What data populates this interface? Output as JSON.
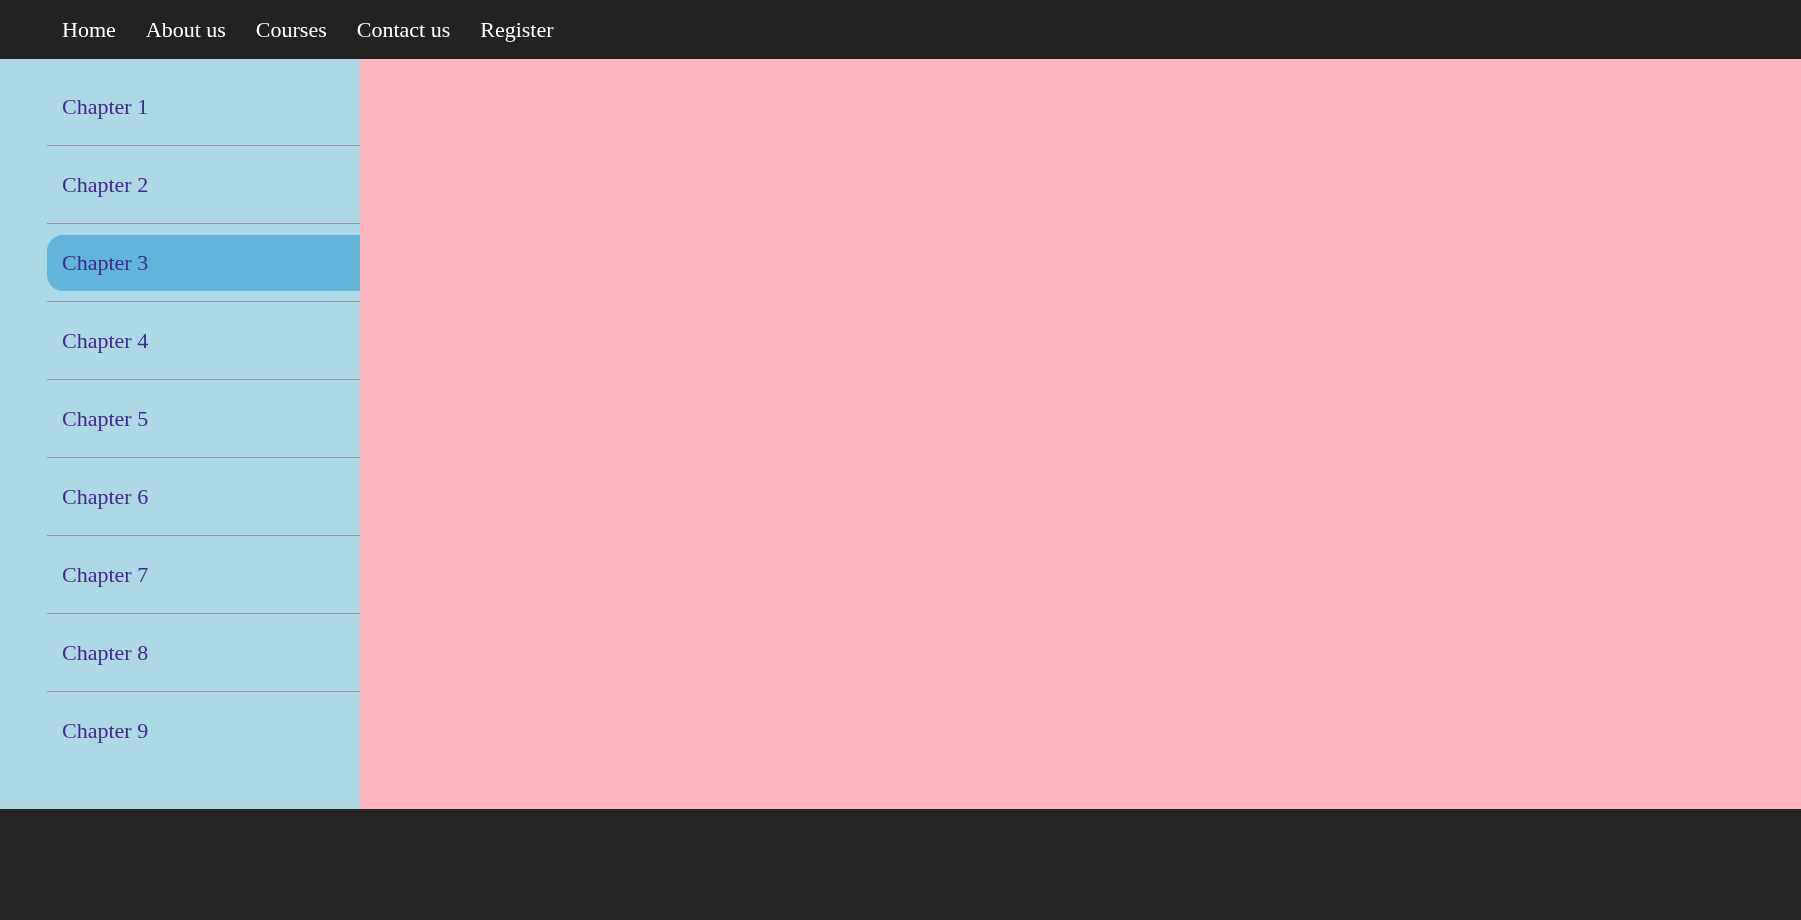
{
  "nav": {
    "items": [
      {
        "label": "Home"
      },
      {
        "label": "About us"
      },
      {
        "label": "Courses"
      },
      {
        "label": "Contact us"
      },
      {
        "label": "Register"
      }
    ]
  },
  "sidebar": {
    "items": [
      {
        "label": "Chapter 1",
        "selected": false
      },
      {
        "label": "Chapter 2",
        "selected": false
      },
      {
        "label": "Chapter 3",
        "selected": true
      },
      {
        "label": "Chapter 4",
        "selected": false
      },
      {
        "label": "Chapter 5",
        "selected": false
      },
      {
        "label": "Chapter 6",
        "selected": false
      },
      {
        "label": "Chapter 7",
        "selected": false
      },
      {
        "label": "Chapter 8",
        "selected": false
      },
      {
        "label": "Chapter 9",
        "selected": false
      }
    ]
  }
}
